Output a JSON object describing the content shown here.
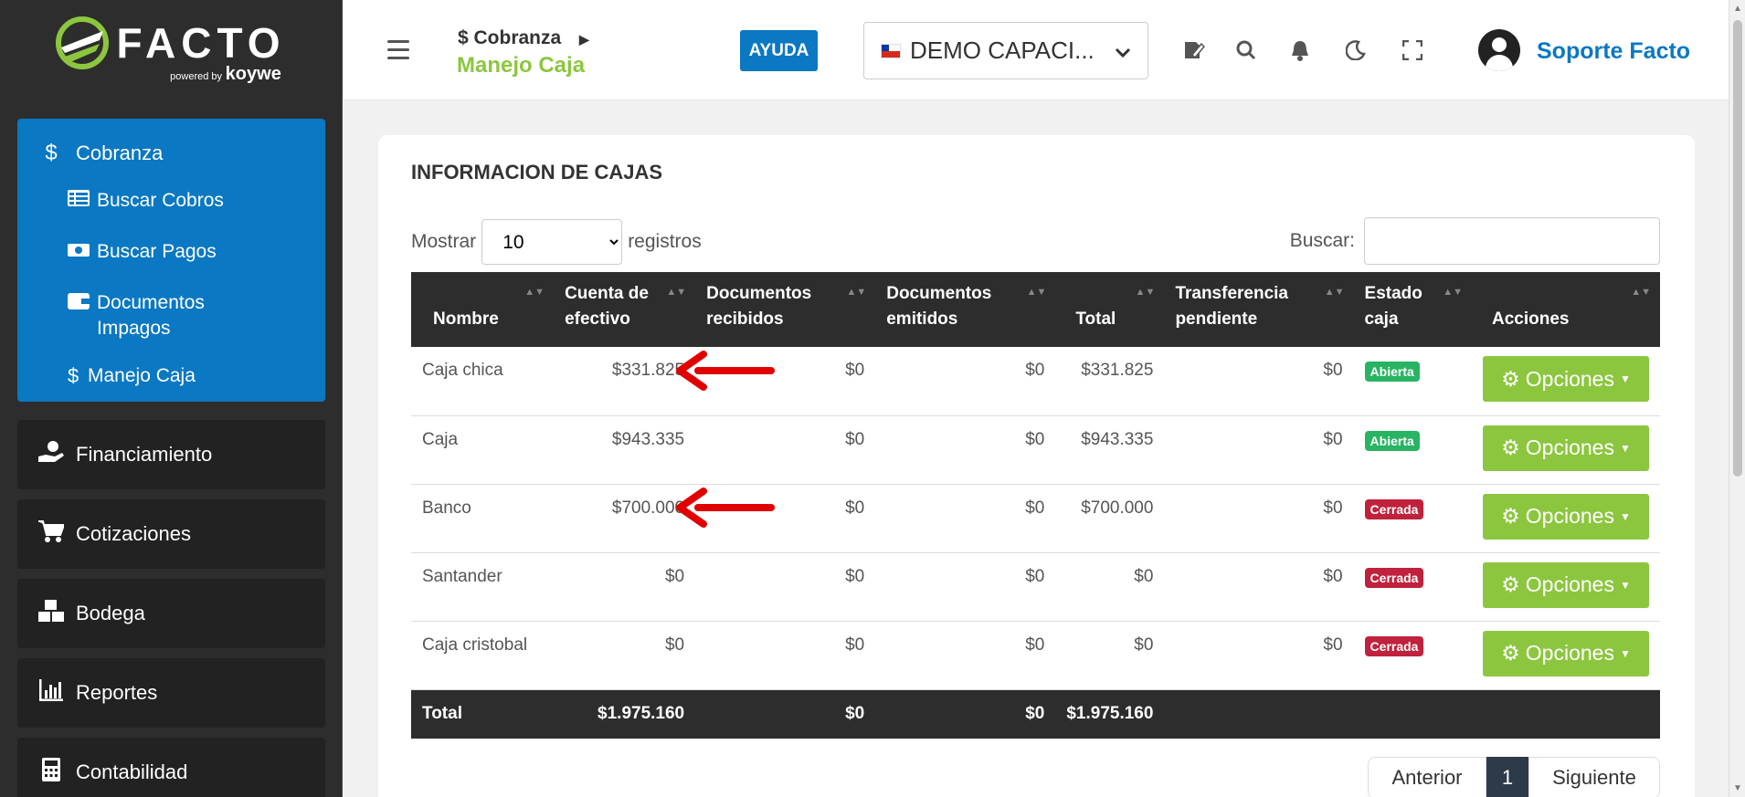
{
  "brand": {
    "name": "FACTO",
    "powered_by": "powered by",
    "company": "koywe"
  },
  "sidebar": {
    "active_section": {
      "label": "Cobranza",
      "icon": "dollar-icon"
    },
    "sub_items": [
      {
        "label": "Buscar Cobros",
        "icon": "list-icon"
      },
      {
        "label": "Buscar Pagos",
        "icon": "money-icon"
      },
      {
        "label": "Documentos Impagos",
        "icon": "wallet-icon"
      },
      {
        "label": "Manejo Caja",
        "icon": "dollar-icon"
      }
    ],
    "sections": [
      {
        "label": "Financiamiento",
        "icon": "hand-money-icon"
      },
      {
        "label": "Cotizaciones",
        "icon": "cart-icon"
      },
      {
        "label": "Bodega",
        "icon": "boxes-icon"
      },
      {
        "label": "Reportes",
        "icon": "chart-icon"
      },
      {
        "label": "Contabilidad",
        "icon": "calculator-icon"
      }
    ]
  },
  "topbar": {
    "breadcrumb": "$ Cobranza",
    "page_title": "Manejo Caja",
    "help_label": "AYUDA",
    "company_selector": "DEMO CAPACI...",
    "user_name": "Soporte Facto"
  },
  "card": {
    "title": "INFORMACION DE CAJAS",
    "length_prefix": "Mostrar",
    "length_value": "10",
    "length_suffix": "registros",
    "search_label": "Buscar:",
    "search_value": ""
  },
  "table": {
    "headers": [
      "Nombre",
      "Cuenta de efectivo",
      "Documentos recibidos",
      "Documentos emitidos",
      "Total",
      "Transferencia pendiente",
      "Estado caja",
      "Acciones"
    ],
    "rows": [
      {
        "nombre": "Caja chica",
        "efectivo": "$331.825",
        "recibidos": "$0",
        "emitidos": "$0",
        "total": "$331.825",
        "transferencia": "$0",
        "estado": "Abierta",
        "accion": "Opciones"
      },
      {
        "nombre": "Caja",
        "efectivo": "$943.335",
        "recibidos": "$0",
        "emitidos": "$0",
        "total": "$943.335",
        "transferencia": "$0",
        "estado": "Abierta",
        "accion": "Opciones"
      },
      {
        "nombre": "Banco",
        "efectivo": "$700.000",
        "recibidos": "$0",
        "emitidos": "$0",
        "total": "$700.000",
        "transferencia": "$0",
        "estado": "Cerrada",
        "accion": "Opciones"
      },
      {
        "nombre": "Santander",
        "efectivo": "$0",
        "recibidos": "$0",
        "emitidos": "$0",
        "total": "$0",
        "transferencia": "$0",
        "estado": "Cerrada",
        "accion": "Opciones"
      },
      {
        "nombre": "Caja cristobal",
        "efectivo": "$0",
        "recibidos": "$0",
        "emitidos": "$0",
        "total": "$0",
        "transferencia": "$0",
        "estado": "Cerrada",
        "accion": "Opciones"
      }
    ],
    "footer": {
      "label": "Total",
      "efectivo": "$1.975.160",
      "recibidos": "$0",
      "emitidos": "$0",
      "total": "$1.975.160"
    }
  },
  "pagination": {
    "prev": "Anterior",
    "current": "1",
    "next": "Siguiente"
  },
  "colors": {
    "primary": "#0a78c2",
    "accent": "#8cc63f",
    "dark": "#2d2d2d",
    "open": "#28b463",
    "closed": "#c0213c",
    "arrow": "#e00000"
  }
}
